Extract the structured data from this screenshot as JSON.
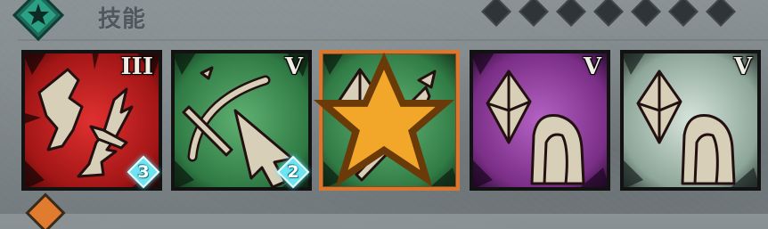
{
  "header": {
    "title": "技能",
    "emblem_icon": "star-emblem-icon",
    "tier_diamonds": 7,
    "diamond_color": "#2e3438"
  },
  "skills": [
    {
      "name": "skill-1",
      "tier": "III",
      "count": "3",
      "theme": "red",
      "icon": "broken-blade-icon",
      "selected": false
    },
    {
      "name": "skill-2",
      "tier": "V",
      "count": "2",
      "theme": "green",
      "icon": "crossbow-cursor-icon",
      "selected": false
    },
    {
      "name": "skill-3",
      "tier": "",
      "count": "",
      "theme": "green",
      "icon": "crystal-spear-icon",
      "selected": true,
      "badge": "star-icon"
    },
    {
      "name": "skill-4",
      "tier": "V",
      "count": "",
      "theme": "purple",
      "icon": "crystal-hand-icon",
      "selected": false
    },
    {
      "name": "skill-5",
      "tier": "V",
      "count": "",
      "theme": "white",
      "icon": "crystal-hand-icon",
      "selected": false
    }
  ],
  "colors": {
    "selected_border": "#d9772f",
    "count_gem": "#6fe3f0",
    "red_bg": "#b11d1d",
    "green_bg": "#3f8a55",
    "purple_bg": "#8a3c95",
    "white_bg": "#a9bdb3"
  }
}
